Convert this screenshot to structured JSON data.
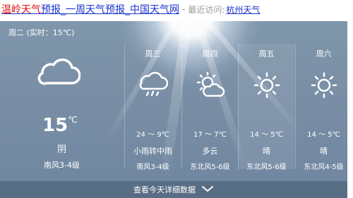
{
  "header": {
    "title_prefix": "温岭天气",
    "title_suffix": "预报_一周天气预报_中国天气网",
    "separator": "-",
    "recent_label": "最近访问:",
    "recent_city": "杭州天气"
  },
  "today": {
    "label": "周二 (实时：15℃)",
    "temp": "15",
    "unit": "℃",
    "condition": "阴",
    "wind": "南风3-4级",
    "icon": "cloud-icon"
  },
  "days": [
    {
      "name": "周三",
      "temp": "24 ～ 9℃",
      "condition": "小雨转中雨",
      "wind": "南风3-4级",
      "icon": "rain-cloud-icon"
    },
    {
      "name": "周四",
      "temp": "17 ～ 7℃",
      "condition": "多云",
      "wind": "东北风5-6级",
      "icon": "partly-cloudy-icon"
    },
    {
      "name": "周五",
      "temp": "14 ～ 5℃",
      "condition": "晴",
      "wind": "东北风5-6级",
      "icon": "sun-icon"
    },
    {
      "name": "周六",
      "temp": "14 ～ 5℃",
      "condition": "晴",
      "wind": "东北风4-5级",
      "icon": "sun-icon"
    }
  ],
  "footer": {
    "label": "查看今天详细数据",
    "icon": "chevron-down-icon"
  },
  "colors": {
    "link": "#1a33cc",
    "highlight_text": "#e01010",
    "panel": "#7a8fa6"
  }
}
